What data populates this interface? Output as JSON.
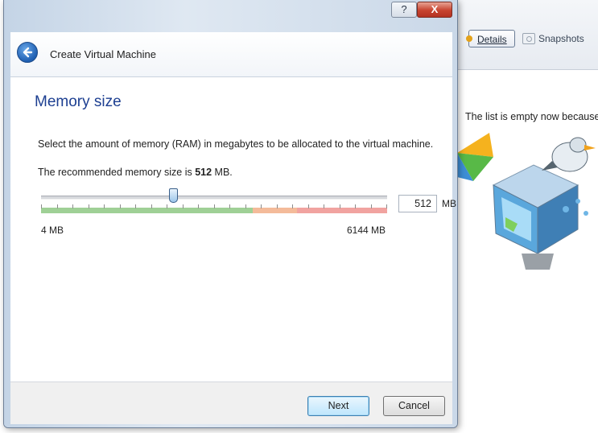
{
  "background_window": {
    "toolbar": {
      "details_label": "Details",
      "snapshots_label": "Snapshots"
    },
    "empty_message": "The list is empty now because"
  },
  "dialog": {
    "help_button": "?",
    "close_button": "X",
    "wizard_title": "Create Virtual Machine",
    "page_heading": "Memory size",
    "description": "Select the amount of memory (RAM) in megabytes to be allocated to the virtual machine.",
    "recommend_prefix": "The recommended memory size is ",
    "recommend_value": "512",
    "recommend_suffix": " MB.",
    "slider": {
      "value": 512,
      "min": 4,
      "max": 6144,
      "min_label": "4 MB",
      "max_label": "6144 MB"
    },
    "memory_value": "512",
    "memory_unit": "MB",
    "buttons": {
      "next": "Next",
      "cancel": "Cancel"
    }
  },
  "colors": {
    "heading": "#1d3f91",
    "band_green": "#9fd096",
    "band_orange": "#f4bb9a",
    "band_red": "#f1a3a0",
    "close_button": "#c7432f"
  }
}
